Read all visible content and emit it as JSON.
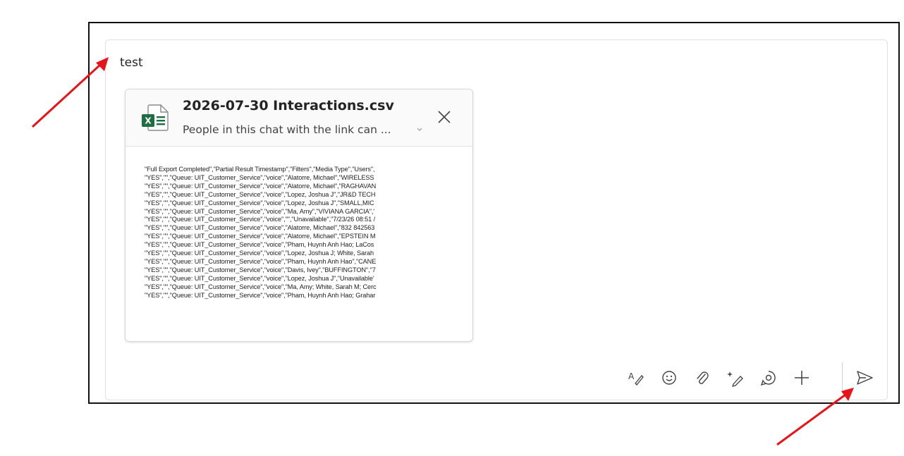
{
  "compose": {
    "message_text": "test"
  },
  "attachment": {
    "file_name": "2026-07-30 Interactions.csv",
    "permission_text": "People in this chat with the link can ...",
    "app_icon_letter": "X",
    "preview_lines": [
      "\"Full Export Completed\",\"Partial Result Timestamp\",\"Filters\",\"Media Type\",\"Users\",",
      "\"YES\",\"\",\"Queue: UIT_Customer_Service\",\"voice\",\"Alatorre, Michael\",\"WIRELESS",
      "\"YES\",\"\",\"Queue: UIT_Customer_Service\",\"voice\",\"Alatorre, Michael\",\"RAGHAVAN",
      "\"YES\",\"\",\"Queue: UIT_Customer_Service\",\"voice\",\"Lopez, Joshua J\",\"JR&D TECH",
      "\"YES\",\"\",\"Queue: UIT_Customer_Service\",\"voice\",\"Lopez, Joshua J\",\"SMALL,MIC",
      "\"YES\",\"\",\"Queue: UIT_Customer_Service\",\"voice\",\"Ma, Amy\",\"VIVIANA GARCIA\",'",
      "\"YES\",\"\",\"Queue: UIT_Customer_Service\",\"voice\",\"\",\"Unavailable\",\"7/23/26 08:51 /",
      "\"YES\",\"\",\"Queue: UIT_Customer_Service\",\"voice\",\"Alatorre, Michael\",\"832 842563",
      "\"YES\",\"\",\"Queue: UIT_Customer_Service\",\"voice\",\"Alatorre, Michael\",\"EPSTEIN M",
      "\"YES\",\"\",\"Queue: UIT_Customer_Service\",\"voice\",\"Pham, Huynh Anh Hao; LaCos",
      "\"YES\",\"\",\"Queue: UIT_Customer_Service\",\"voice\",\"Lopez, Joshua J; White, Sarah",
      "\"YES\",\"\",\"Queue: UIT_Customer_Service\",\"voice\",\"Pham, Huynh Anh Hao\",\"CANE",
      "\"YES\",\"\",\"Queue: UIT_Customer_Service\",\"voice\",\"Davis, Ivey\",\"BUFFINGTON\",\"7",
      "\"YES\",\"\",\"Queue: UIT_Customer_Service\",\"voice\",\"Lopez, Joshua J\",\"Unavailable'",
      "\"YES\",\"\",\"Queue: UIT_Customer_Service\",\"voice\",\"Ma, Amy; White, Sarah M; Cerc",
      "\"YES\",\"\",\"Queue: UIT_Customer_Service\",\"voice\",\"Pham, Huynh Anh Hao; Grahar"
    ]
  },
  "toolbar": {
    "buttons": [
      "format-icon",
      "emoji-icon",
      "attach-icon",
      "copilot-icon",
      "loop-icon",
      "plus-icon"
    ],
    "send": "send-icon"
  },
  "colors": {
    "excel_green": "#1D6F42",
    "annotation_red": "#E8141A",
    "frame": "#111111"
  }
}
